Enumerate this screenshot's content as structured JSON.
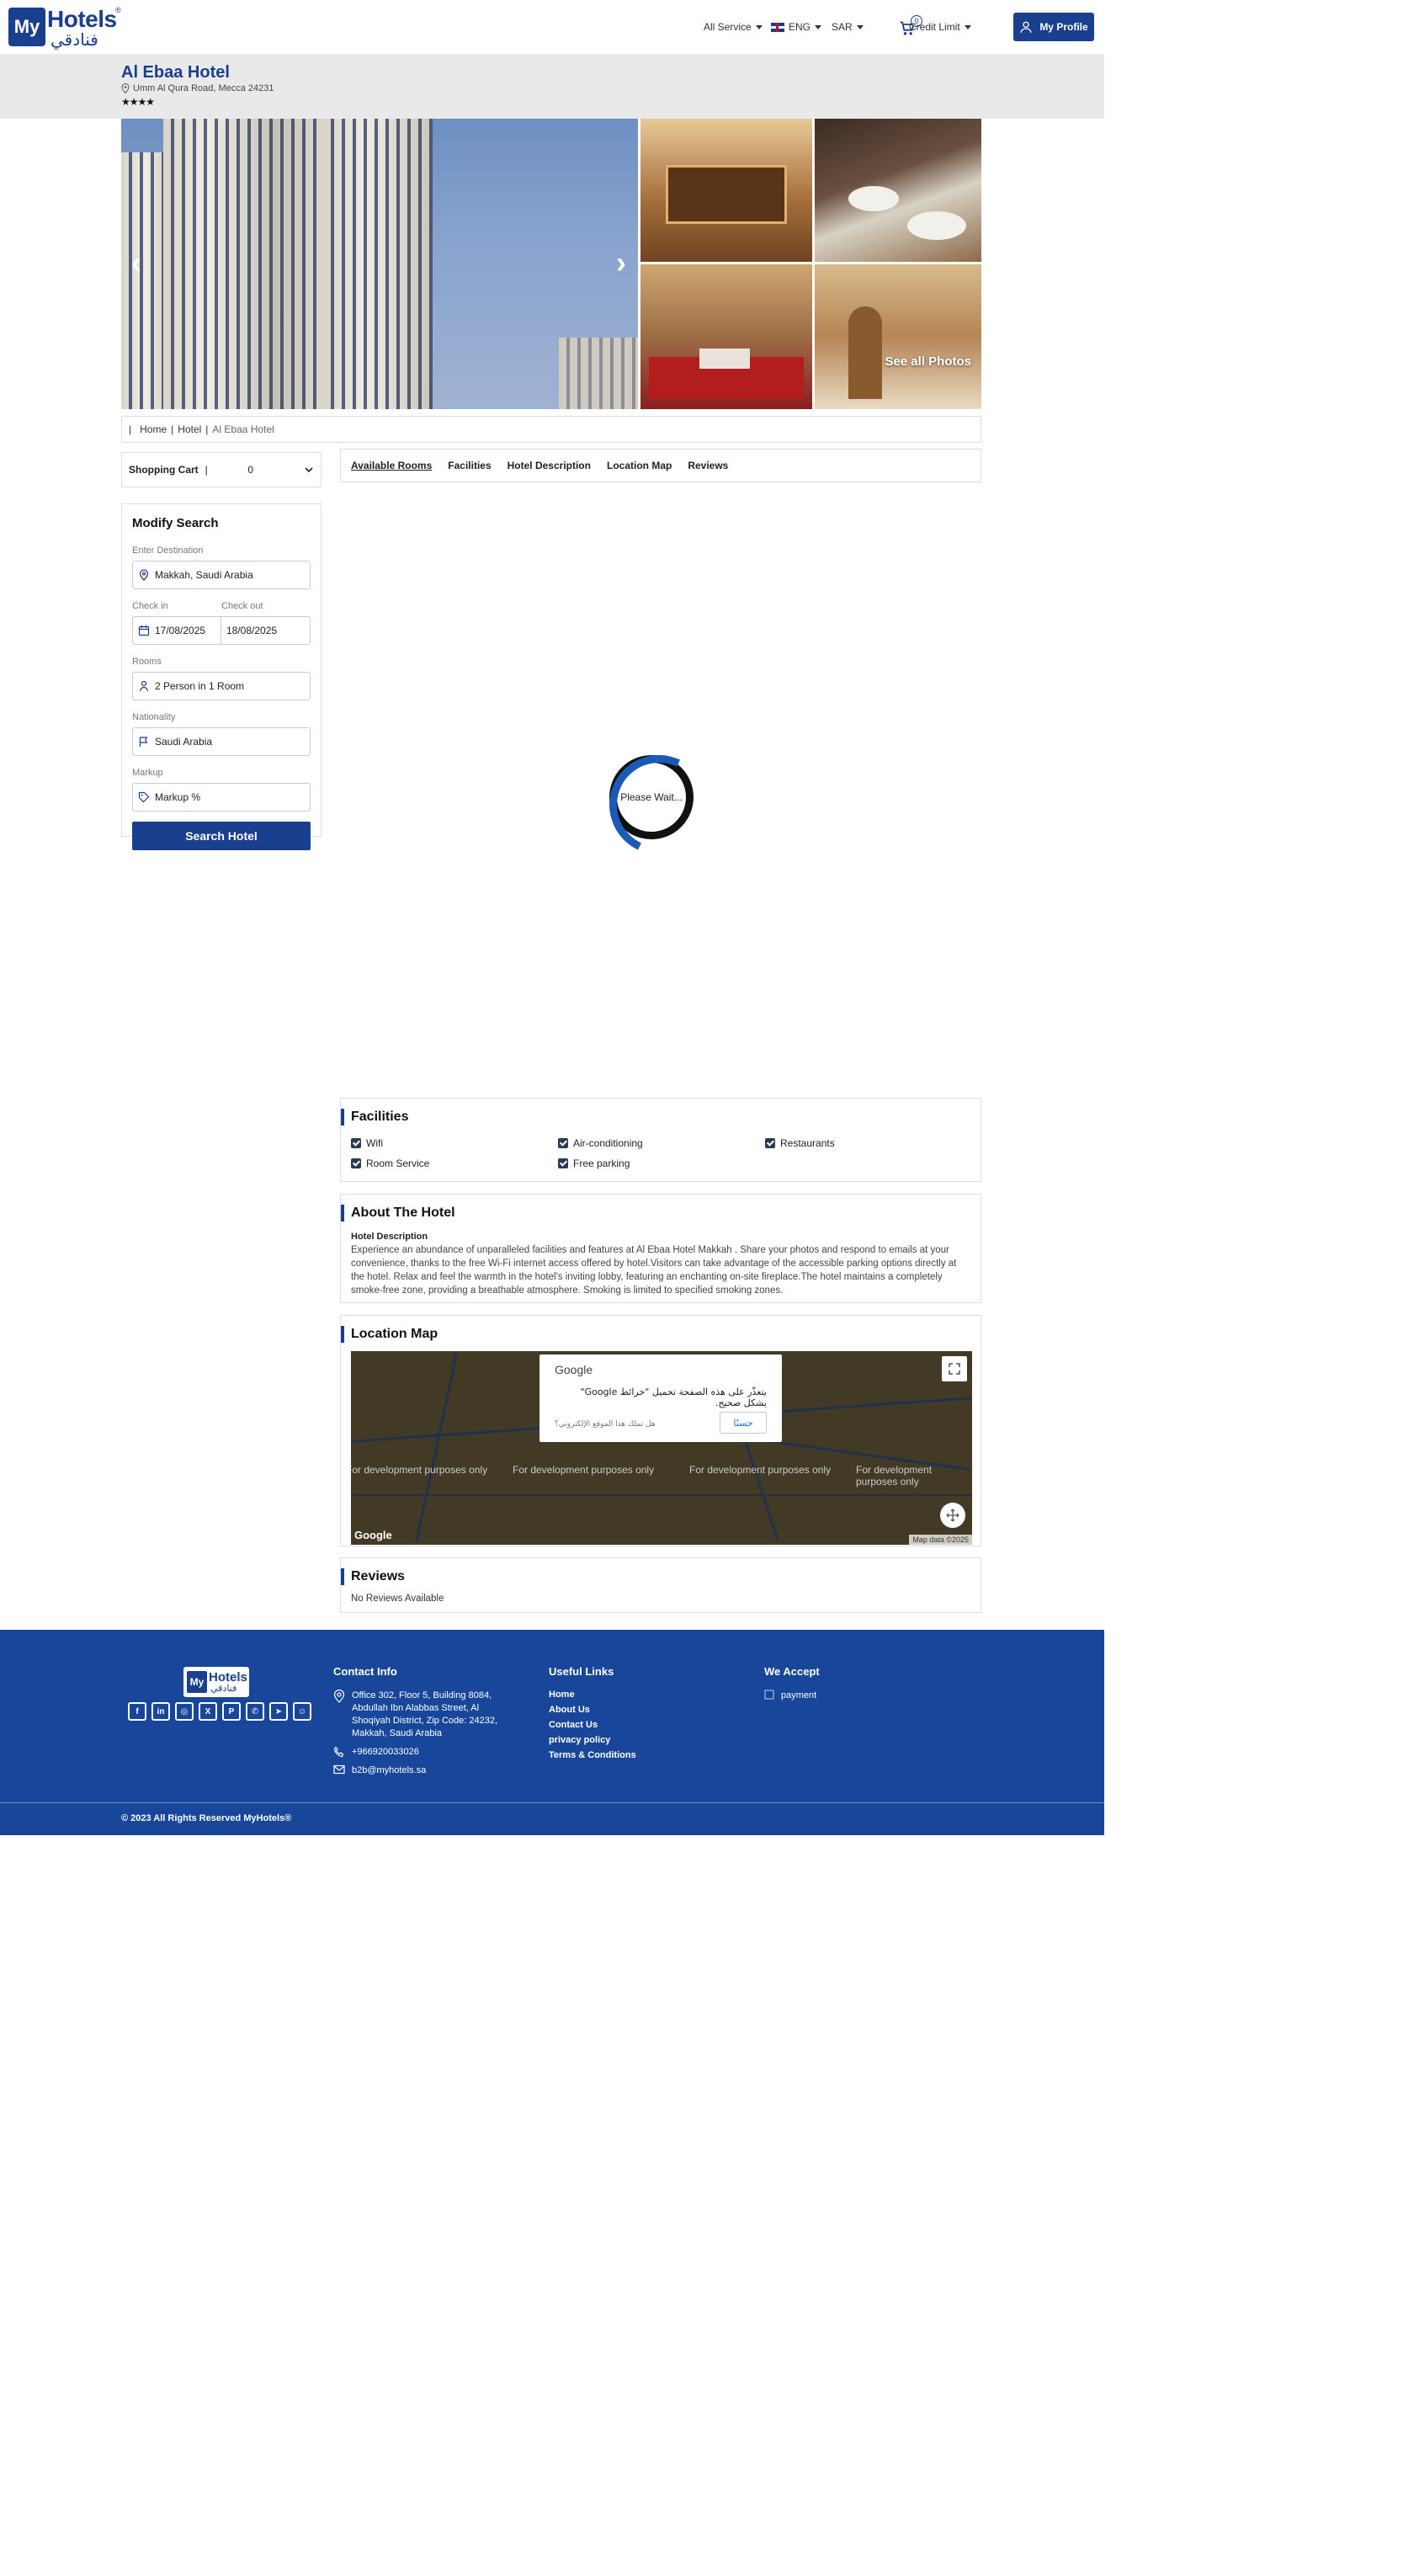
{
  "header": {
    "logo_my": "My",
    "logo_hotels": "Hotels",
    "logo_ar": "فنادقي",
    "logo_reg": "®",
    "service": "All Service",
    "language": "ENG",
    "currency": "SAR",
    "cart_count": "0",
    "credit_limit": "Credit Limit",
    "profile": "My Profile"
  },
  "hotel": {
    "name": "Al Ebaa Hotel",
    "address": "Umm Al Qura Road, Mecca 24231",
    "stars": "★★★★",
    "see_all_photos": "See all Photos"
  },
  "breadcrumb": {
    "home": "Home",
    "hotel": "Hotel",
    "current": "Al Ebaa Hotel"
  },
  "sidebar": {
    "cart_label": "Shopping Cart",
    "cart_count": "0",
    "title": "Modify Search",
    "destination_label": "Enter Destination",
    "destination": "Makkah, Saudi Arabia",
    "checkin_label": "Check in",
    "checkin": "17/08/2025",
    "checkout_label": "Check out",
    "checkout": "18/08/2025",
    "rooms_label": "Rooms",
    "rooms": "2 Person in 1 Room",
    "nationality_label": "Nationality",
    "nationality": "Saudi Arabia",
    "markup_label": "Markup",
    "markup_placeholder": "Markup %",
    "search_button": "Search Hotel"
  },
  "tabs": [
    "Available Rooms",
    "Facilities",
    "Hotel Description",
    "Location Map",
    "Reviews"
  ],
  "loader": "Please Wait...",
  "facilities": {
    "title": "Facilities",
    "items": [
      "Wifi",
      "Air-conditioning",
      "Restaurants",
      "Room Service",
      "Free parking"
    ]
  },
  "about": {
    "title": "About The Hotel",
    "subtitle": "Hotel Description",
    "text": "Experience an abundance of unparalleled facilities and features at Al Ebaa Hotel Makkah . Share your photos and respond to emails at your convenience, thanks to the free Wi-Fi internet access offered by hotel.Visitors can take advantage of the accessible parking options directly at the hotel. Relax and feel the warmth in the hotel's inviting lobby, featuring an enchanting on-site fireplace.The hotel maintains a completely smoke-free zone, providing a breathable atmosphere. Smoking is limited to specified smoking zones."
  },
  "location": {
    "title": "Location Map",
    "dev_text": "For development purposes only",
    "dialog_title": "Google",
    "dialog_msg": "يتعذّر على هذه الصفحة تحميل \"خرائط Google\" بشكل صحيح.",
    "dialog_own": "هل تملك هذا الموقع الإلكتروني؟",
    "dialog_ok": "حسنًا",
    "attribution": "Map data ©2025",
    "google": "Google"
  },
  "reviews": {
    "title": "Reviews",
    "empty": "No Reviews Available"
  },
  "footer": {
    "contact_title": "Contact Info",
    "address": "Office 302, Floor 5, Building 8084, Abdullah Ibn Alabbas Street, Al Shoqiyah District, Zip Code: 24232, Makkah, Saudi Arabia",
    "phone": "+966920033026",
    "email": "b2b@myhotels.sa",
    "links_title": "Useful Links",
    "links": [
      "Home",
      "About Us",
      "Contact Us",
      "privacy policy",
      "Terms & Conditions"
    ],
    "accept_title": "We Accept",
    "payment_alt": "payment",
    "copyright": "© 2023 All Rights Reserved MyHotels®"
  },
  "colors": {
    "brand": "#1a3f8f",
    "footer": "#17469a",
    "band": "#e9e9e9"
  }
}
